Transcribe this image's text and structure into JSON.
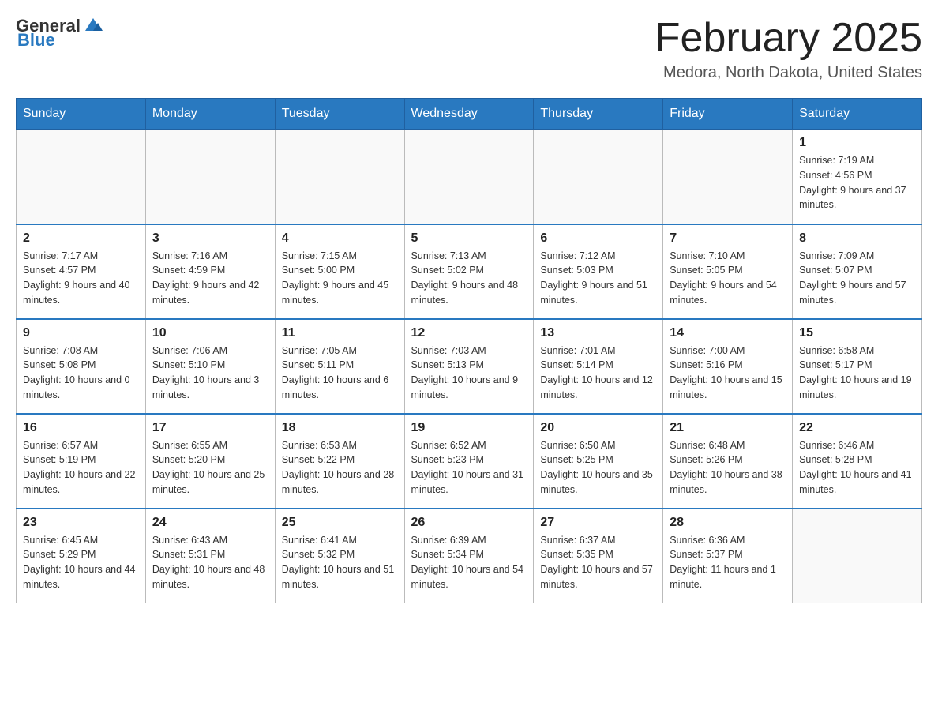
{
  "header": {
    "logo_general": "General",
    "logo_blue": "Blue",
    "month_title": "February 2025",
    "location": "Medora, North Dakota, United States"
  },
  "days_of_week": [
    "Sunday",
    "Monday",
    "Tuesday",
    "Wednesday",
    "Thursday",
    "Friday",
    "Saturday"
  ],
  "weeks": [
    [
      {
        "day": "",
        "info": ""
      },
      {
        "day": "",
        "info": ""
      },
      {
        "day": "",
        "info": ""
      },
      {
        "day": "",
        "info": ""
      },
      {
        "day": "",
        "info": ""
      },
      {
        "day": "",
        "info": ""
      },
      {
        "day": "1",
        "info": "Sunrise: 7:19 AM\nSunset: 4:56 PM\nDaylight: 9 hours and 37 minutes."
      }
    ],
    [
      {
        "day": "2",
        "info": "Sunrise: 7:17 AM\nSunset: 4:57 PM\nDaylight: 9 hours and 40 minutes."
      },
      {
        "day": "3",
        "info": "Sunrise: 7:16 AM\nSunset: 4:59 PM\nDaylight: 9 hours and 42 minutes."
      },
      {
        "day": "4",
        "info": "Sunrise: 7:15 AM\nSunset: 5:00 PM\nDaylight: 9 hours and 45 minutes."
      },
      {
        "day": "5",
        "info": "Sunrise: 7:13 AM\nSunset: 5:02 PM\nDaylight: 9 hours and 48 minutes."
      },
      {
        "day": "6",
        "info": "Sunrise: 7:12 AM\nSunset: 5:03 PM\nDaylight: 9 hours and 51 minutes."
      },
      {
        "day": "7",
        "info": "Sunrise: 7:10 AM\nSunset: 5:05 PM\nDaylight: 9 hours and 54 minutes."
      },
      {
        "day": "8",
        "info": "Sunrise: 7:09 AM\nSunset: 5:07 PM\nDaylight: 9 hours and 57 minutes."
      }
    ],
    [
      {
        "day": "9",
        "info": "Sunrise: 7:08 AM\nSunset: 5:08 PM\nDaylight: 10 hours and 0 minutes."
      },
      {
        "day": "10",
        "info": "Sunrise: 7:06 AM\nSunset: 5:10 PM\nDaylight: 10 hours and 3 minutes."
      },
      {
        "day": "11",
        "info": "Sunrise: 7:05 AM\nSunset: 5:11 PM\nDaylight: 10 hours and 6 minutes."
      },
      {
        "day": "12",
        "info": "Sunrise: 7:03 AM\nSunset: 5:13 PM\nDaylight: 10 hours and 9 minutes."
      },
      {
        "day": "13",
        "info": "Sunrise: 7:01 AM\nSunset: 5:14 PM\nDaylight: 10 hours and 12 minutes."
      },
      {
        "day": "14",
        "info": "Sunrise: 7:00 AM\nSunset: 5:16 PM\nDaylight: 10 hours and 15 minutes."
      },
      {
        "day": "15",
        "info": "Sunrise: 6:58 AM\nSunset: 5:17 PM\nDaylight: 10 hours and 19 minutes."
      }
    ],
    [
      {
        "day": "16",
        "info": "Sunrise: 6:57 AM\nSunset: 5:19 PM\nDaylight: 10 hours and 22 minutes."
      },
      {
        "day": "17",
        "info": "Sunrise: 6:55 AM\nSunset: 5:20 PM\nDaylight: 10 hours and 25 minutes."
      },
      {
        "day": "18",
        "info": "Sunrise: 6:53 AM\nSunset: 5:22 PM\nDaylight: 10 hours and 28 minutes."
      },
      {
        "day": "19",
        "info": "Sunrise: 6:52 AM\nSunset: 5:23 PM\nDaylight: 10 hours and 31 minutes."
      },
      {
        "day": "20",
        "info": "Sunrise: 6:50 AM\nSunset: 5:25 PM\nDaylight: 10 hours and 35 minutes."
      },
      {
        "day": "21",
        "info": "Sunrise: 6:48 AM\nSunset: 5:26 PM\nDaylight: 10 hours and 38 minutes."
      },
      {
        "day": "22",
        "info": "Sunrise: 6:46 AM\nSunset: 5:28 PM\nDaylight: 10 hours and 41 minutes."
      }
    ],
    [
      {
        "day": "23",
        "info": "Sunrise: 6:45 AM\nSunset: 5:29 PM\nDaylight: 10 hours and 44 minutes."
      },
      {
        "day": "24",
        "info": "Sunrise: 6:43 AM\nSunset: 5:31 PM\nDaylight: 10 hours and 48 minutes."
      },
      {
        "day": "25",
        "info": "Sunrise: 6:41 AM\nSunset: 5:32 PM\nDaylight: 10 hours and 51 minutes."
      },
      {
        "day": "26",
        "info": "Sunrise: 6:39 AM\nSunset: 5:34 PM\nDaylight: 10 hours and 54 minutes."
      },
      {
        "day": "27",
        "info": "Sunrise: 6:37 AM\nSunset: 5:35 PM\nDaylight: 10 hours and 57 minutes."
      },
      {
        "day": "28",
        "info": "Sunrise: 6:36 AM\nSunset: 5:37 PM\nDaylight: 11 hours and 1 minute."
      },
      {
        "day": "",
        "info": ""
      }
    ]
  ]
}
